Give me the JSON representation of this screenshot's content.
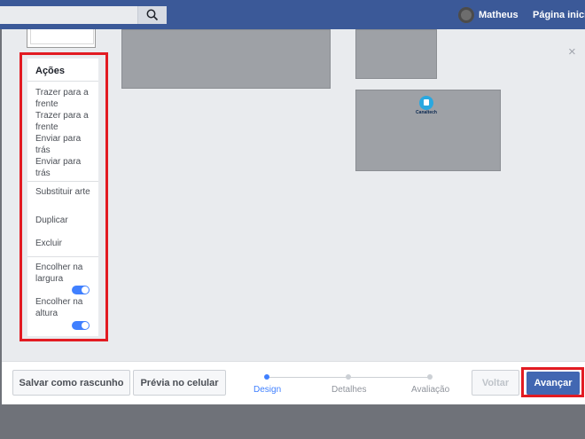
{
  "header": {
    "search_icon": "search-icon",
    "user_name": "Matheus",
    "home_link": "Página inicial"
  },
  "actions_panel": {
    "title": "Ações",
    "items": [
      "Trazer para a frente",
      "Trazer para a frente",
      "Enviar para trás",
      "Enviar para trás",
      "Substituir arte",
      "Duplicar",
      "Excluir",
      "Encolher na largura",
      "Encolher na altura"
    ],
    "toggles": {
      "shrink_width": true,
      "shrink_height": true
    }
  },
  "canvas": {
    "logo_text": "Canaltech"
  },
  "close_icon": "close-icon",
  "footer": {
    "save_draft": "Salvar como rascunho",
    "mobile_preview": "Prévia no celular",
    "steps": [
      "Design",
      "Detalhes",
      "Avaliação"
    ],
    "active_step": "Design",
    "back": "Voltar",
    "next": "Avançar"
  },
  "colors": {
    "header_bg": "#3b5998",
    "primary": "#4267b2",
    "active_step": "#4080ff",
    "highlight": "#e21b22"
  }
}
